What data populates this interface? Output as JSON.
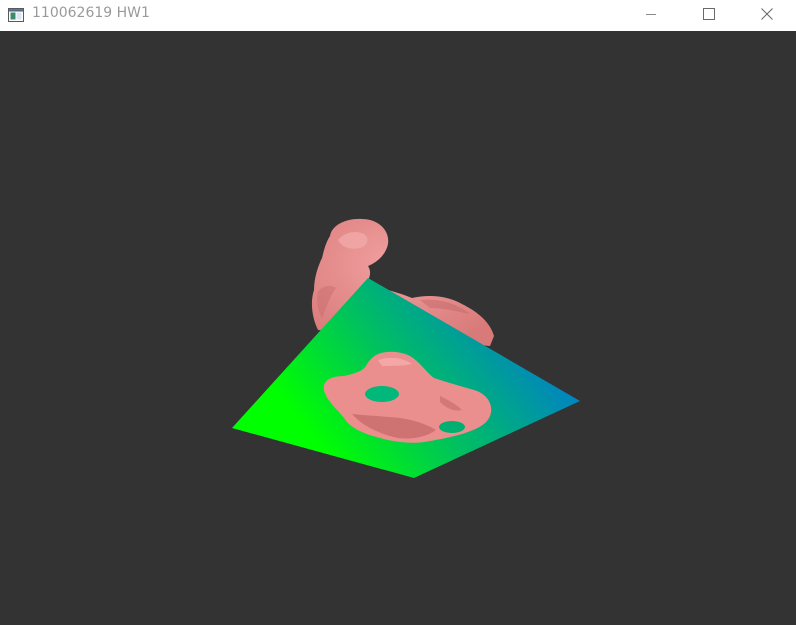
{
  "window": {
    "title": "110062619 HW1",
    "icon": "application-window-icon"
  },
  "caption_buttons": {
    "minimize": "minimize-icon",
    "maximize": "maximize-icon",
    "close": "close-icon"
  },
  "scene": {
    "background_color": "#333333",
    "plane_gradient_colors": [
      "#00ff00",
      "#0080c8"
    ],
    "model_color": "#e88a8a",
    "model_shadow_color": "#c46868"
  }
}
